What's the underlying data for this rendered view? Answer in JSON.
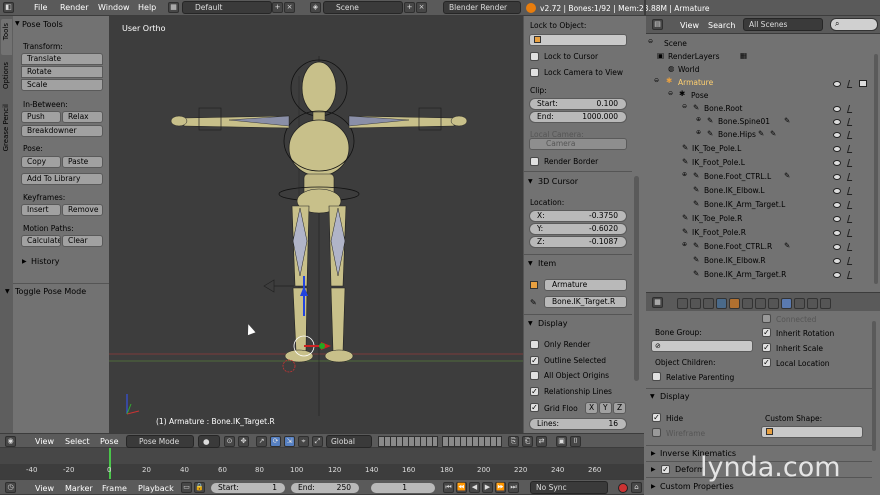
{
  "top_menu": {
    "file": "File",
    "render": "Render",
    "window": "Window",
    "help": "Help"
  },
  "top_bar": {
    "layout": "Default",
    "scene": "Scene",
    "engine": "Blender Render",
    "stats": "v2.72 | Bones:1/92 | Mem:23.88M | Armature"
  },
  "tool_tabs": [
    "Tools",
    "Options",
    "Grease Pencil"
  ],
  "pose_tools": {
    "title": "Pose Tools",
    "transform_label": "Transform:",
    "translate": "Translate",
    "rotate": "Rotate",
    "scale": "Scale",
    "inbetween_label": "In-Between:",
    "push": "Push",
    "relax": "Relax",
    "breakdowner": "Breakdowner",
    "pose_label": "Pose:",
    "copy": "Copy",
    "paste": "Paste",
    "add_library": "Add To Library",
    "keyframes_label": "Keyframes:",
    "insert": "Insert",
    "remove": "Remove",
    "motion_label": "Motion Paths:",
    "calculate": "Calculate",
    "clear": "Clear",
    "history": "History",
    "toggle_pose": "Toggle Pose Mode"
  },
  "viewport": {
    "view_name": "User Ortho",
    "object_info": "(1) Armature : Bone.IK_Target.R"
  },
  "view_props": {
    "lock_object": "Lock to Object:",
    "lock_cursor": "Lock to Cursor",
    "lock_camera": "Lock Camera to View",
    "clip": "Clip:",
    "start_label": "Start:",
    "start_val": "0.100",
    "end_label": "End:",
    "end_val": "1000.000",
    "local_camera": "Local Camera:",
    "camera": "Camera",
    "render_border": "Render Border",
    "cursor_title": "3D Cursor",
    "location": "Location:",
    "x_label": "X:",
    "x_val": "-0.3750",
    "y_label": "Y:",
    "y_val": "-0.6020",
    "z_label": "Z:",
    "z_val": "-0.1087",
    "item_title": "Item",
    "item_name": "Armature",
    "bone_name": "Bone.IK_Target.R",
    "display_title": "Display",
    "only_render": "Only Render",
    "outline_selected": "Outline Selected",
    "all_origins": "All Object Origins",
    "rel_lines": "Relationship Lines",
    "grid_floor": "Grid Floo",
    "axis_x": "X",
    "axis_y": "Y",
    "axis_z": "Z",
    "lines_label": "Lines:",
    "lines_val": "16"
  },
  "viewport_header": {
    "view": "View",
    "select": "Select",
    "pose": "Pose",
    "mode": "Pose Mode",
    "orientation": "Global"
  },
  "outliner": {
    "view": "View",
    "search": "Search",
    "filter": "All Scenes",
    "items": [
      "Scene",
      "RenderLayers",
      "World",
      "Armature",
      "Pose",
      "Bone.Root",
      "Bone.Spine01",
      "Bone.Hips",
      "IK_Toe_Pole.L",
      "IK_Foot_Pole.L",
      "Bone.Foot_CTRL.L",
      "Bone.IK_Elbow.L",
      "Bone.IK_Arm_Target.L",
      "IK_Toe_Pole.R",
      "IK_Foot_Pole.R",
      "Bone.Foot_CTRL.R",
      "Bone.IK_Elbow.R",
      "Bone.IK_Arm_Target.R"
    ]
  },
  "bone_props": {
    "connected": "Connected",
    "bone_group": "Bone Group:",
    "inherit_rotation": "Inherit Rotation",
    "object_children": "Object Children:",
    "inherit_scale": "Inherit Scale",
    "local_location": "Local Location",
    "relative_parenting": "Relative Parenting",
    "display_title": "Display",
    "hide": "Hide",
    "custom_shape": "Custom Shape:",
    "wireframe": "Wireframe",
    "inverse_kinematics": "Inverse Kinematics",
    "deform": "Deform",
    "custom_properties": "Custom Properties"
  },
  "timeline": {
    "ticks": [
      "-40",
      "-20",
      "0",
      "20",
      "40",
      "60",
      "80",
      "100",
      "120",
      "140",
      "160",
      "180",
      "200",
      "220",
      "240",
      "260"
    ],
    "view": "View",
    "marker": "Marker",
    "frame": "Frame",
    "playback": "Playback",
    "start_label": "Start:",
    "start_val": "1",
    "end_label": "End:",
    "end_val": "250",
    "current": "1",
    "sync": "No Sync"
  },
  "watermark": "lynda.com"
}
